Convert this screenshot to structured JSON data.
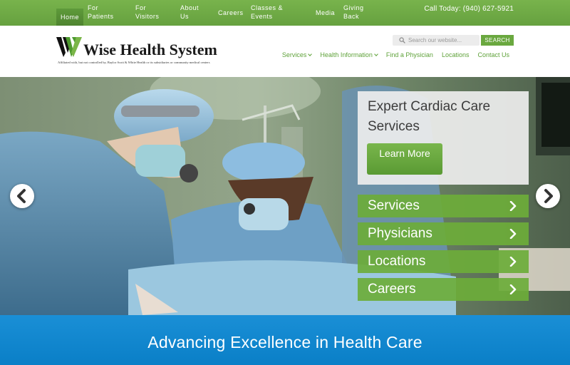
{
  "topbar": {
    "items": [
      {
        "label": "Home"
      },
      {
        "label": "For\nPatients"
      },
      {
        "label": "For\nVisitors"
      },
      {
        "label": "About\nUs"
      },
      {
        "label": "Careers"
      },
      {
        "label": "Classes &\nEvents"
      },
      {
        "label": "Media"
      },
      {
        "label": "Giving\nBack"
      }
    ],
    "call": "Call Today: (940) 627-5921"
  },
  "header": {
    "logo_text": "Wise Health System",
    "logo_sub": "Affiliated with, but not controlled by, Baylor Scott & White Health or its subsidiaries or community medical centers",
    "search_placeholder": "Search our website...",
    "search_button": "SEARCH",
    "nav": [
      {
        "label": "Services"
      },
      {
        "label": "Health Information"
      },
      {
        "label": "Find a Physician"
      },
      {
        "label": "Locations"
      },
      {
        "label": "Contact Us"
      }
    ]
  },
  "hero": {
    "feature_title": "Expert Cardiac Care Services",
    "learn_more": "Learn More",
    "links": [
      {
        "label": "Services"
      },
      {
        "label": "Physicians"
      },
      {
        "label": "Locations"
      },
      {
        "label": "Careers"
      }
    ]
  },
  "banner": {
    "tagline": "Advancing Excellence in Health Care"
  },
  "colors": {
    "brand_green": "#70ad47",
    "banner_blue": "#0c86cf"
  }
}
